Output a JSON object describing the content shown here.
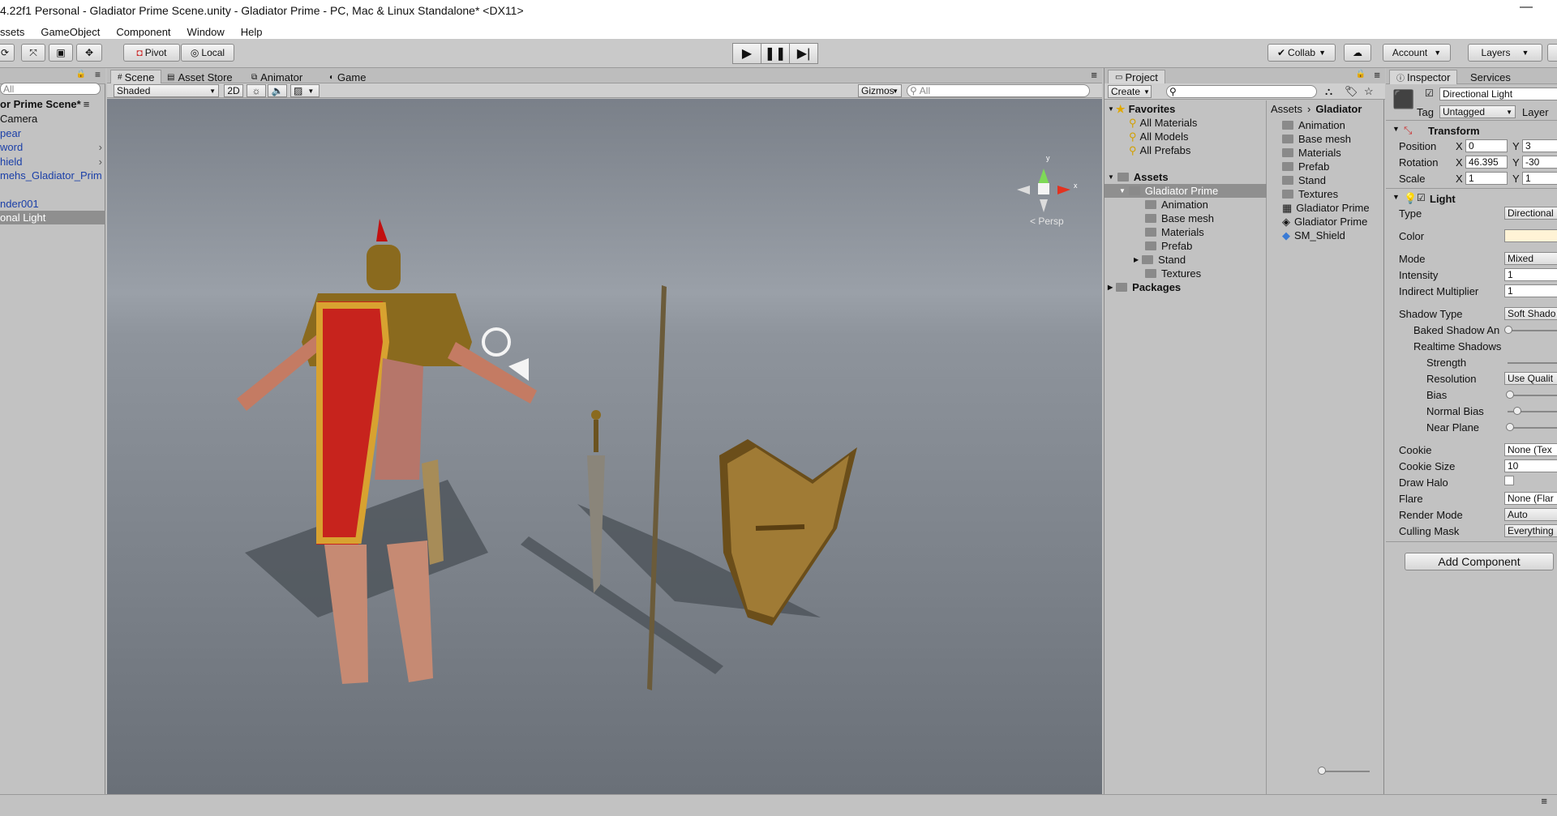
{
  "title": "4.22f1 Personal - Gladiator Prime Scene.unity - Gladiator Prime - PC, Mac & Linux Standalone* <DX11>",
  "menu": [
    "ssets",
    "GameObject",
    "Component",
    "Window",
    "Help"
  ],
  "toolbar": {
    "pivot": "Pivot",
    "local": "Local",
    "collab": "Collab",
    "account": "Account",
    "layers": "Layers"
  },
  "hierarchy": {
    "search": "All",
    "scene": "or Prime Scene*",
    "items": [
      "Camera",
      "pear",
      "word",
      "hield",
      "mehs_Gladiator_Prim",
      "nder001",
      "onal Light"
    ]
  },
  "scene": {
    "tabs": [
      "Scene",
      "Asset Store",
      "Animator",
      "Game"
    ],
    "shading": "Shaded",
    "mode2d": "2D",
    "gizmos": "Gizmos",
    "search_placeholder": "All",
    "persp": "< Persp",
    "gizmo_x": "x",
    "gizmo_y": "y"
  },
  "project": {
    "tab": "Project",
    "create": "Create",
    "favorites_label": "Favorites",
    "favorites": [
      "All Materials",
      "All Models",
      "All Prefabs"
    ],
    "assets_label": "Assets",
    "root": "Gladiator Prime",
    "folders": [
      "Animation",
      "Base mesh",
      "Materials",
      "Prefab",
      "Stand",
      "Textures"
    ],
    "packages": "Packages",
    "breadcrumb_root": "Assets",
    "breadcrumb_current": "Gladiator",
    "right_items": [
      "Animation",
      "Base mesh",
      "Materials",
      "Prefab",
      "Stand",
      "Textures",
      "Gladiator Prime",
      "Gladiator Prime",
      "SM_Shield"
    ]
  },
  "inspector": {
    "tabs": [
      "Inspector",
      "Services"
    ],
    "object_name": "Directional Light",
    "tag_label": "Tag",
    "tag_value": "Untagged",
    "layer_label": "Layer",
    "transform": {
      "title": "Transform",
      "position_label": "Position",
      "pos_x": "0",
      "pos_y": "3",
      "rotation_label": "Rotation",
      "rot_x": "46.395",
      "rot_y": "-30",
      "scale_label": "Scale",
      "scale_x": "1",
      "scale_y": "1",
      "x": "X",
      "y": "Y"
    },
    "light": {
      "title": "Light",
      "type_label": "Type",
      "type_value": "Directional",
      "color_label": "Color",
      "mode_label": "Mode",
      "mode_value": "Mixed",
      "intensity_label": "Intensity",
      "intensity_value": "1",
      "indirect_label": "Indirect Multiplier",
      "indirect_value": "1",
      "shadow_type_label": "Shadow Type",
      "shadow_type_value": "Soft Shado",
      "baked_label": "Baked Shadow An",
      "realtime_label": "Realtime Shadows",
      "strength_label": "Strength",
      "resolution_label": "Resolution",
      "resolution_value": "Use Qualit",
      "bias_label": "Bias",
      "normal_bias_label": "Normal Bias",
      "near_plane_label": "Near Plane",
      "cookie_label": "Cookie",
      "cookie_value": "None (Tex",
      "cookie_size_label": "Cookie Size",
      "cookie_size_value": "10",
      "halo_label": "Draw Halo",
      "flare_label": "Flare",
      "flare_value": "None (Flar",
      "render_label": "Render Mode",
      "render_value": "Auto",
      "culling_label": "Culling Mask",
      "culling_value": "Everything"
    },
    "add_component": "Add Component"
  },
  "colors": {
    "sky": "#9da3ab",
    "ground": "#6f757d",
    "light_color": "#fff3d6"
  }
}
